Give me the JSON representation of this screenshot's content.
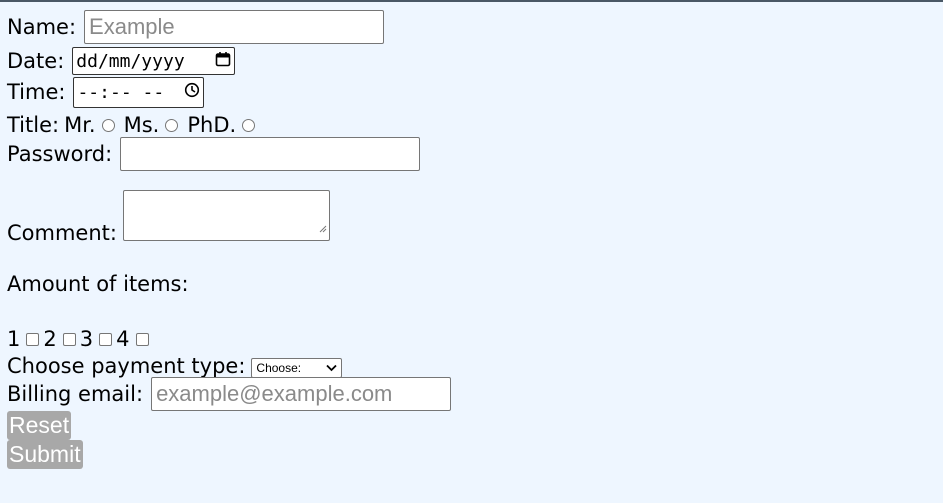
{
  "form": {
    "name": {
      "label": "Name:",
      "placeholder": "Example"
    },
    "date": {
      "label": "Date:",
      "placeholder": "dd/mm/yyyy"
    },
    "time": {
      "label": "Time:",
      "placeholder": "--:-- --"
    },
    "title": {
      "label": "Title:",
      "options": [
        "Mr.",
        "Ms.",
        "PhD."
      ]
    },
    "password": {
      "label": "Password:"
    },
    "comment": {
      "label": "Comment:"
    },
    "amount": {
      "label": "Amount of items:",
      "options": [
        "1",
        "2",
        "3",
        "4"
      ]
    },
    "payment": {
      "label": "Choose payment type:",
      "selected": "Choose:"
    },
    "email": {
      "label": "Billing email:",
      "placeholder": "example@example.com"
    },
    "reset_label": "Reset",
    "submit_label": "Submit"
  },
  "icons": {
    "calendar": "calendar-icon",
    "clock": "clock-icon",
    "dropdown": "chevron-down-icon"
  },
  "colors": {
    "background": "#eef6ff",
    "button_bg": "#a8a8a8",
    "button_text": "#ffffff",
    "placeholder": "#8a8a8a"
  }
}
